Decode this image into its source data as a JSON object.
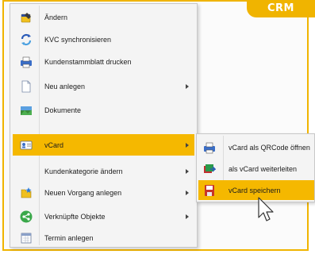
{
  "badge": "CRM",
  "colors": {
    "accent": "#f0b400",
    "highlight": "#f5b800"
  },
  "menu": {
    "items": [
      {
        "label": "Ändern",
        "icon": "edit-pencil-icon",
        "submenu": false
      },
      {
        "label": "KVC synchronisieren",
        "icon": "sync-icon",
        "submenu": false
      },
      {
        "label": "Kundenstammblatt drucken",
        "icon": "print-icon",
        "submenu": false
      },
      {
        "label": "Neu anlegen",
        "icon": "new-document-icon",
        "submenu": true
      },
      {
        "label": "Dokumente",
        "icon": "documents-icon",
        "submenu": false
      },
      {
        "label": "vCard",
        "icon": "vcard-icon",
        "submenu": true,
        "highlighted": true
      },
      {
        "label": "Kundenkategorie ändern",
        "icon": "",
        "submenu": true
      },
      {
        "label": "Neuen Vorgang anlegen",
        "icon": "new-process-icon",
        "submenu": true
      },
      {
        "label": "Verknüpfte Objekte",
        "icon": "link-icon",
        "submenu": true
      },
      {
        "label": "Termin anlegen",
        "icon": "calendar-icon",
        "submenu": false
      }
    ]
  },
  "submenu": {
    "items": [
      {
        "label": "vCard als QRCode öffnen",
        "icon": "qr-code-icon"
      },
      {
        "label": "als vCard weiterleiten",
        "icon": "forward-mail-icon"
      },
      {
        "label": "vCard speichern",
        "icon": "save-icon",
        "highlighted": true
      }
    ]
  }
}
